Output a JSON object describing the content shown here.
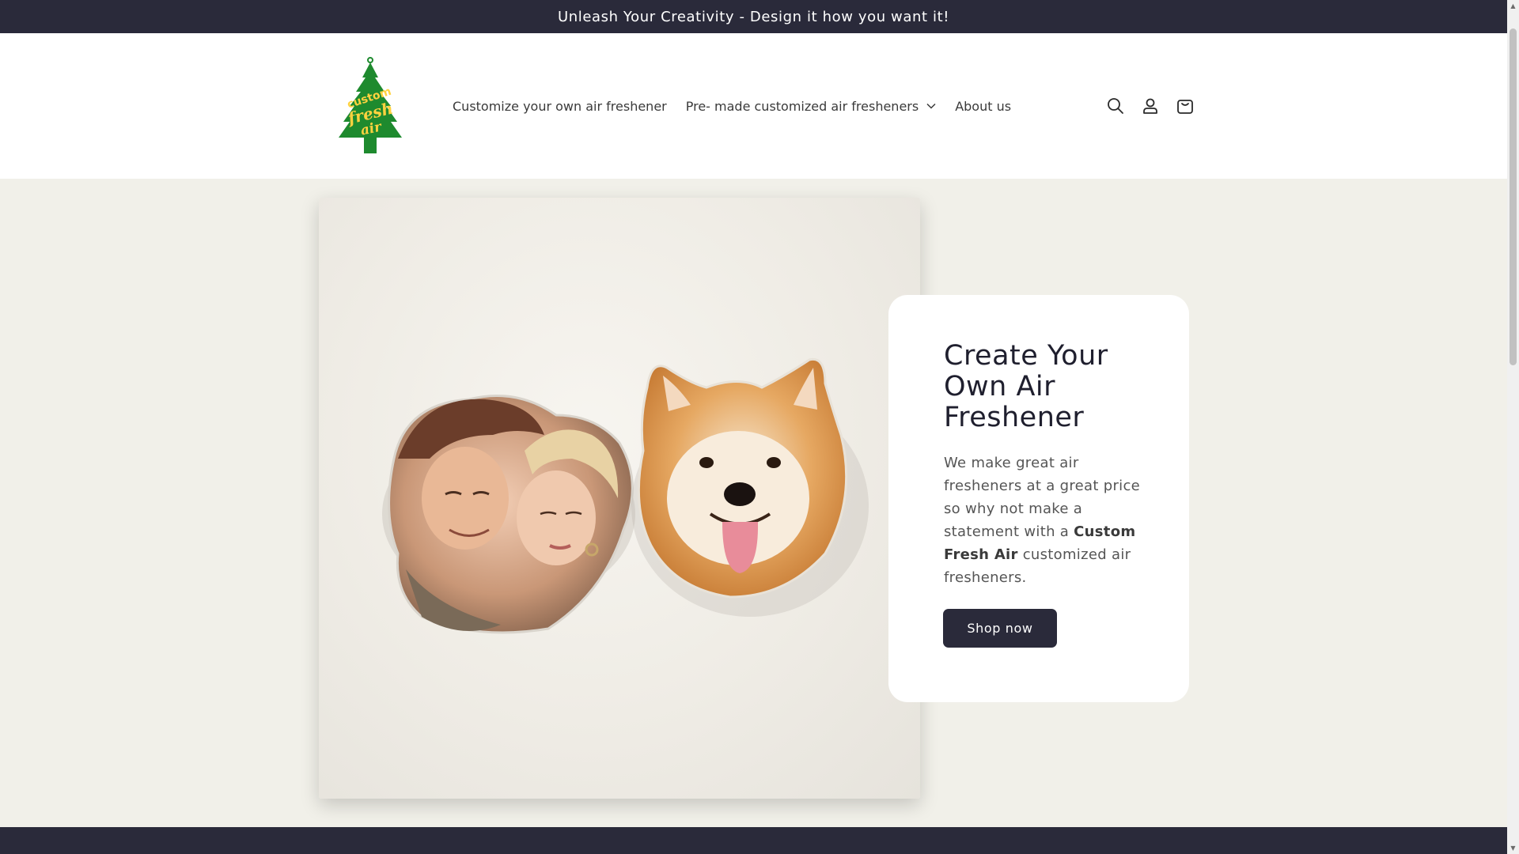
{
  "announcement": {
    "text": "Unleash Your Creativity - Design it how you want it!"
  },
  "header": {
    "logo_text": [
      "custom",
      "fresh",
      "air"
    ],
    "nav": [
      {
        "label": "Customize your own air freshener",
        "has_dropdown": false
      },
      {
        "label": "Pre- made customized air fresheners",
        "has_dropdown": true
      },
      {
        "label": "About us",
        "has_dropdown": false
      }
    ],
    "icons": [
      "search-icon",
      "account-icon",
      "cart-icon"
    ]
  },
  "hero": {
    "title": "Create Your Own Air Freshener",
    "text_before": "We make great air fresheners at a great price so why not make a statement with a ",
    "text_bold": "Custom Fresh Air",
    "text_after": " customized air fresheners.",
    "button_label": "Shop now"
  },
  "colors": {
    "dark": "#2a2a3a",
    "logo_green": "#1e8a2e",
    "logo_yellow": "#ffd23f",
    "hero_bg": "#f1f0e9"
  }
}
